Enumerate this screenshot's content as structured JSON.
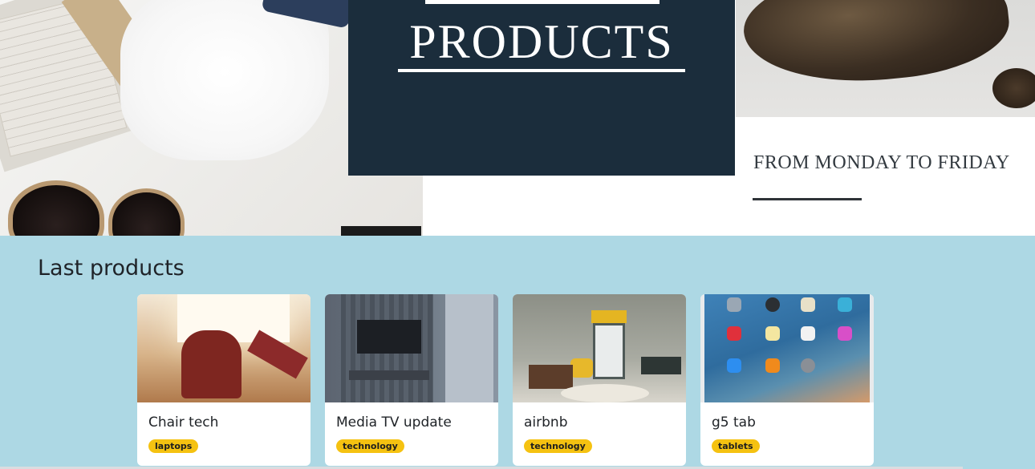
{
  "hero": {
    "banner_word": "PRODUCTS",
    "schedule_text": "FROM MONDAY TO FRIDAY"
  },
  "last_products": {
    "title": "Last products",
    "cards": [
      {
        "name": "Chair tech",
        "tag": "laptops",
        "image": "living-room-chair-photo"
      },
      {
        "name": "Media TV update",
        "tag": "technology",
        "image": "tv-wall-photo"
      },
      {
        "name": "airbnb",
        "tag": "technology",
        "image": "room-interior-photo"
      },
      {
        "name": "g5 tab",
        "tag": "tablets",
        "image": "tablet-homescreen-photo"
      }
    ]
  },
  "colors": {
    "banner_bg": "#1b2d3c",
    "section_bg": "#add8e4",
    "tag_bg": "#f5c211"
  }
}
